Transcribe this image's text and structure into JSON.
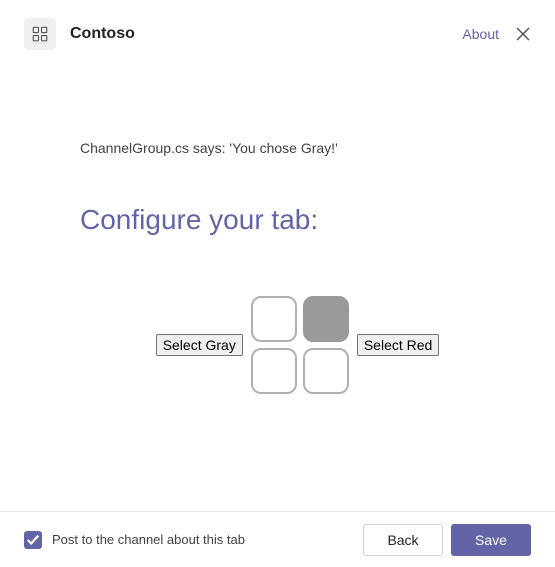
{
  "header": {
    "app_title": "Contoso",
    "about_label": "About"
  },
  "content": {
    "status_text": "ChannelGroup.cs says: 'You chose Gray!'",
    "heading": "Configure your tab:",
    "select_gray_label": "Select Gray",
    "select_red_label": "Select Red"
  },
  "footer": {
    "checkbox_label": "Post to the channel about this tab",
    "checkbox_checked": true,
    "back_label": "Back",
    "save_label": "Save"
  },
  "colors": {
    "accent": "#6264a7",
    "tile_filled": "#9a9a9a"
  }
}
